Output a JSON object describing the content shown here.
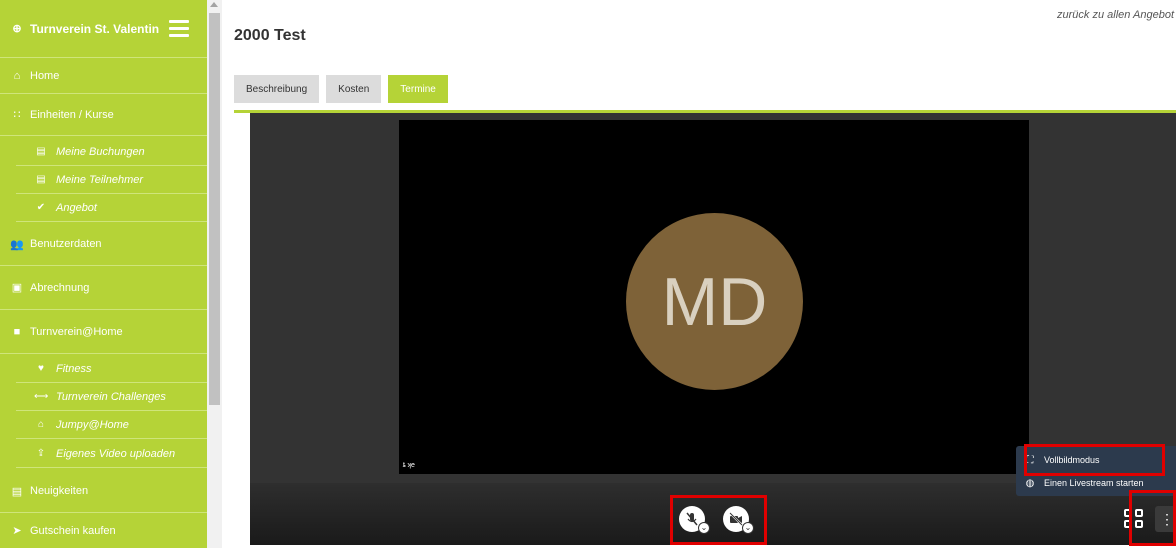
{
  "sidebar": {
    "brand": "Turnverein St. Valentin",
    "items": [
      {
        "icon": "home-icon",
        "glyph": "⌂",
        "label": "Home"
      },
      {
        "icon": "grid-icon",
        "glyph": "∷",
        "label": "Einheiten / Kurse"
      },
      {
        "icon": "list-icon",
        "glyph": "▤",
        "label": "Meine Buchungen"
      },
      {
        "icon": "list-icon",
        "glyph": "▤",
        "label": "Meine Teilnehmer"
      },
      {
        "icon": "check-icon",
        "glyph": "✔",
        "label": "Angebot"
      },
      {
        "icon": "users-icon",
        "glyph": "👥",
        "label": "Benutzerdaten"
      },
      {
        "icon": "money-icon",
        "glyph": "▣",
        "label": "Abrechnung"
      },
      {
        "icon": "video-icon",
        "glyph": "■",
        "label": "Turnverein@Home"
      },
      {
        "icon": "heart-icon",
        "glyph": "♥",
        "label": "Fitness"
      },
      {
        "icon": "dumbbell-icon",
        "glyph": "⟷",
        "label": "Turnverein Challenges"
      },
      {
        "icon": "home-icon",
        "glyph": "⌂",
        "label": "Jumpy@Home"
      },
      {
        "icon": "upload-icon",
        "glyph": "⇪",
        "label": "Eigenes Video uploaden"
      },
      {
        "icon": "news-icon",
        "glyph": "▤",
        "label": "Neuigkeiten"
      },
      {
        "icon": "tag-icon",
        "glyph": "➤",
        "label": "Gutschein kaufen"
      }
    ]
  },
  "header": {
    "back_link": "zurück zu allen Angebot",
    "title": "2000 Test"
  },
  "tabs": [
    {
      "label": "Beschreibung",
      "active": false
    },
    {
      "label": "Kosten",
      "active": false
    },
    {
      "label": "Termine",
      "active": true
    }
  ],
  "video": {
    "avatar_initials": "MD",
    "participant_label": "ȶ ʞe",
    "menu": [
      {
        "icon": "fullscreen-icon",
        "glyph": "⛶",
        "label": "Vollbildmodus"
      },
      {
        "icon": "globe-icon",
        "glyph": "◍",
        "label": "Einen Livestream starten"
      }
    ],
    "more_glyph": "⋮"
  },
  "colors": {
    "accent": "#b5d337",
    "avatar": "#7e6238",
    "highlight": "#e00000",
    "menu_bg": "#2c3a4d"
  }
}
